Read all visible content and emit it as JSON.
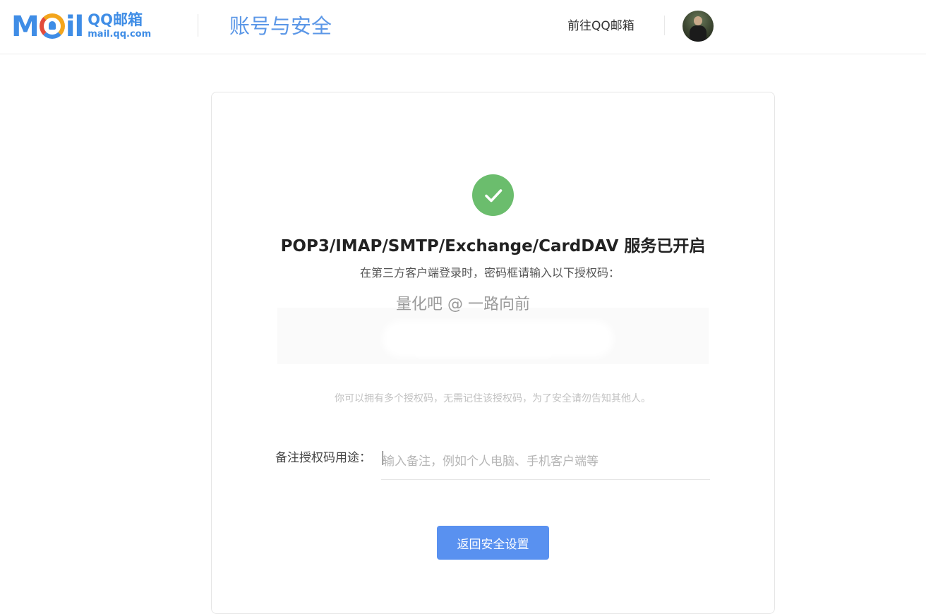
{
  "header": {
    "logo_letters": [
      "M",
      "i",
      "l"
    ],
    "logo_cn": "QQ邮箱",
    "logo_en": "mail.qq.com",
    "title": "账号与安全",
    "goto_link": "前往QQ邮箱"
  },
  "main": {
    "status_title": "POP3/IMAP/SMTP/Exchange/CardDAV 服务已开启",
    "instruction": "在第三方客户端登录时，密码框请输入以下授权码：",
    "watermark": "量化吧 @ 一路向前",
    "hint": "你可以拥有多个授权码，无需记住该授权码，为了安全请勿告知其他人。",
    "note_label": "备注授权码用途：",
    "note_input": {
      "value": "",
      "placeholder": "输入备注，例如个人电脑、手机客户端等"
    },
    "back_button": "返回安全设置"
  },
  "colors": {
    "brand_blue": "#3f8de6",
    "success_green": "#6bbd6d",
    "button_blue": "#5991f0"
  },
  "icons": {
    "success": "check-circle-icon",
    "avatar": "user-avatar"
  }
}
